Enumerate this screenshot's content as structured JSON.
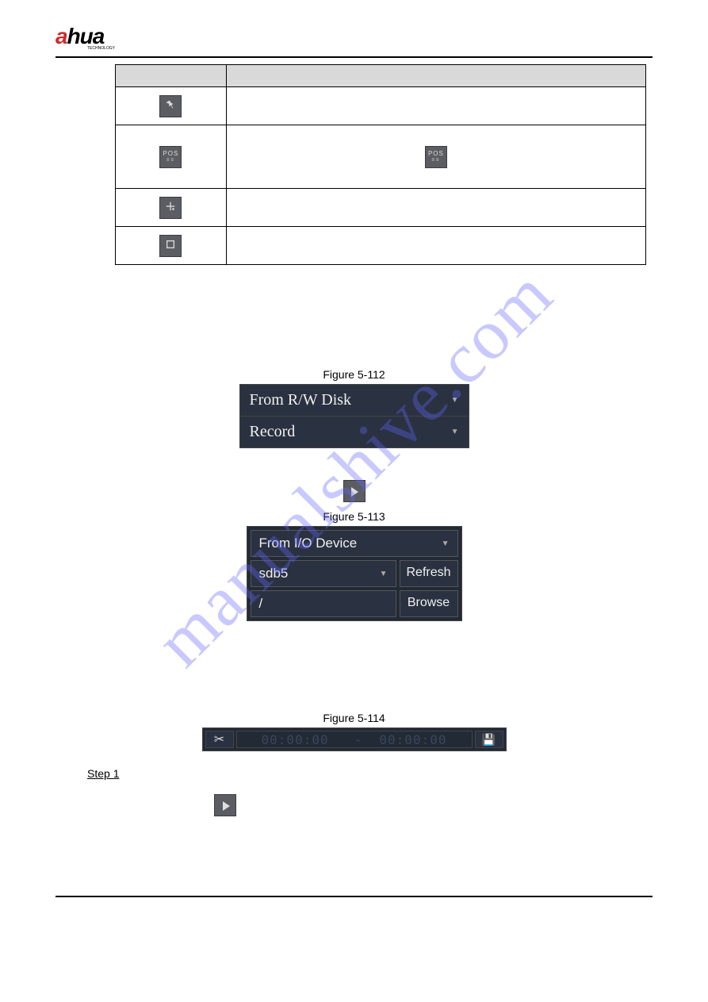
{
  "brand": {
    "letter": "a",
    "rest": "hua",
    "sub": "TECHNOLOGY"
  },
  "watermark": "manualshive.com",
  "figures": {
    "f112": {
      "caption": "Figure 5-112",
      "row1": "From R/W Disk",
      "row2": "Record"
    },
    "f113": {
      "caption": "Figure 5-113",
      "row1": "From I/O Device",
      "row2": "sdb5",
      "btn_refresh": "Refresh",
      "btn_browse": "Browse",
      "path": "/"
    },
    "f114": {
      "caption": "Figure 5-114",
      "t1": "00:00:00",
      "sep": "-",
      "t2": "00:00:00"
    }
  },
  "step": "Step 1"
}
